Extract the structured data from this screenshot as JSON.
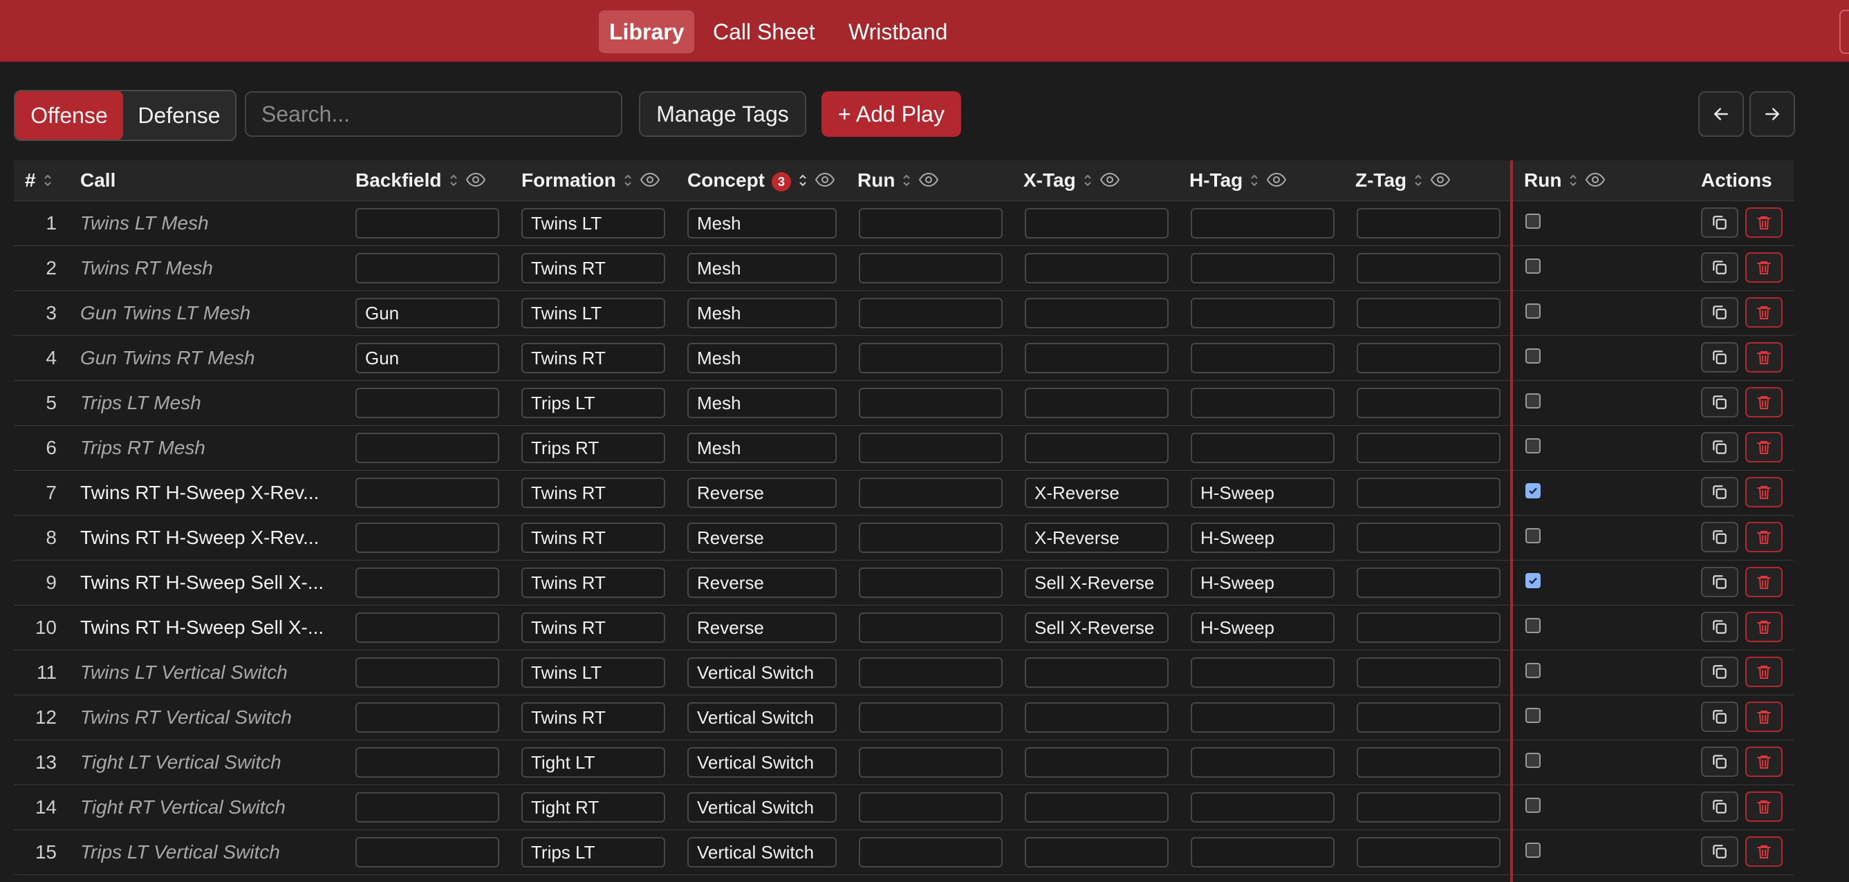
{
  "nav": {
    "tabs": [
      {
        "label": "Library",
        "active": true
      },
      {
        "label": "Call Sheet",
        "active": false
      },
      {
        "label": "Wristband",
        "active": false
      }
    ]
  },
  "toolbar": {
    "side_toggle": [
      {
        "label": "Offense",
        "active": true
      },
      {
        "label": "Defense",
        "active": false
      }
    ],
    "search_placeholder": "Search...",
    "search_value": "",
    "manage_tags_label": "Manage Tags",
    "add_play_label": "+ Add Play",
    "prev_icon": "arrow-left-icon",
    "next_icon": "arrow-right-icon"
  },
  "table": {
    "columns": {
      "num": "#",
      "call": "Call",
      "backfield": "Backfield",
      "formation": "Formation",
      "concept": "Concept",
      "concept_badge": "3",
      "run": "Run",
      "xtag": "X-Tag",
      "htag": "H-Tag",
      "ztag": "Z-Tag",
      "run_flag": "Run",
      "actions": "Actions"
    },
    "rows": [
      {
        "num": "1",
        "call": "Twins LT Mesh",
        "call_is_placeholder": true,
        "backfield": "",
        "formation": "Twins LT",
        "concept": "Mesh",
        "run": "",
        "xtag": "",
        "htag": "",
        "ztag": "",
        "run_flag": false
      },
      {
        "num": "2",
        "call": "Twins RT Mesh",
        "call_is_placeholder": true,
        "backfield": "",
        "formation": "Twins RT",
        "concept": "Mesh",
        "run": "",
        "xtag": "",
        "htag": "",
        "ztag": "",
        "run_flag": false
      },
      {
        "num": "3",
        "call": "Gun Twins LT Mesh",
        "call_is_placeholder": true,
        "backfield": "Gun",
        "formation": "Twins LT",
        "concept": "Mesh",
        "run": "",
        "xtag": "",
        "htag": "",
        "ztag": "",
        "run_flag": false
      },
      {
        "num": "4",
        "call": "Gun Twins RT Mesh",
        "call_is_placeholder": true,
        "backfield": "Gun",
        "formation": "Twins RT",
        "concept": "Mesh",
        "run": "",
        "xtag": "",
        "htag": "",
        "ztag": "",
        "run_flag": false
      },
      {
        "num": "5",
        "call": "Trips LT Mesh",
        "call_is_placeholder": true,
        "backfield": "",
        "formation": "Trips LT",
        "concept": "Mesh",
        "run": "",
        "xtag": "",
        "htag": "",
        "ztag": "",
        "run_flag": false
      },
      {
        "num": "6",
        "call": "Trips RT Mesh",
        "call_is_placeholder": true,
        "backfield": "",
        "formation": "Trips RT",
        "concept": "Mesh",
        "run": "",
        "xtag": "",
        "htag": "",
        "ztag": "",
        "run_flag": false
      },
      {
        "num": "7",
        "call": "Twins RT H-Sweep X-Rev...",
        "call_is_placeholder": false,
        "backfield": "",
        "formation": "Twins RT",
        "concept": "Reverse",
        "run": "",
        "xtag": "X-Reverse",
        "htag": "H-Sweep",
        "ztag": "",
        "run_flag": true
      },
      {
        "num": "8",
        "call": "Twins RT H-Sweep X-Rev...",
        "call_is_placeholder": false,
        "backfield": "",
        "formation": "Twins RT",
        "concept": "Reverse",
        "run": "",
        "xtag": "X-Reverse",
        "htag": "H-Sweep",
        "ztag": "",
        "run_flag": false
      },
      {
        "num": "9",
        "call": "Twins RT H-Sweep Sell X-...",
        "call_is_placeholder": false,
        "backfield": "",
        "formation": "Twins RT",
        "concept": "Reverse",
        "run": "",
        "xtag": "Sell X-Reverse",
        "htag": "H-Sweep",
        "ztag": "",
        "run_flag": true
      },
      {
        "num": "10",
        "call": "Twins RT H-Sweep Sell X-...",
        "call_is_placeholder": false,
        "backfield": "",
        "formation": "Twins RT",
        "concept": "Reverse",
        "run": "",
        "xtag": "Sell X-Reverse",
        "htag": "H-Sweep",
        "ztag": "",
        "run_flag": false
      },
      {
        "num": "11",
        "call": "Twins LT Vertical Switch",
        "call_is_placeholder": true,
        "backfield": "",
        "formation": "Twins LT",
        "concept": "Vertical Switch",
        "run": "",
        "xtag": "",
        "htag": "",
        "ztag": "",
        "run_flag": false
      },
      {
        "num": "12",
        "call": "Twins RT Vertical Switch",
        "call_is_placeholder": true,
        "backfield": "",
        "formation": "Twins RT",
        "concept": "Vertical Switch",
        "run": "",
        "xtag": "",
        "htag": "",
        "ztag": "",
        "run_flag": false
      },
      {
        "num": "13",
        "call": "Tight LT Vertical Switch",
        "call_is_placeholder": true,
        "backfield": "",
        "formation": "Tight LT",
        "concept": "Vertical Switch",
        "run": "",
        "xtag": "",
        "htag": "",
        "ztag": "",
        "run_flag": false
      },
      {
        "num": "14",
        "call": "Tight RT Vertical Switch",
        "call_is_placeholder": true,
        "backfield": "",
        "formation": "Tight RT",
        "concept": "Vertical Switch",
        "run": "",
        "xtag": "",
        "htag": "",
        "ztag": "",
        "run_flag": false
      },
      {
        "num": "15",
        "call": "Trips LT Vertical Switch",
        "call_is_placeholder": true,
        "backfield": "",
        "formation": "Trips LT",
        "concept": "Vertical Switch",
        "run": "",
        "xtag": "",
        "htag": "",
        "ztag": "",
        "run_flag": false
      }
    ],
    "row_icons": {
      "copy": "copy-icon",
      "delete": "trash-icon"
    }
  },
  "colors": {
    "accent": "#a5262b",
    "background": "#1c1c1c",
    "checkbox_checked": "#8ab4f8"
  }
}
